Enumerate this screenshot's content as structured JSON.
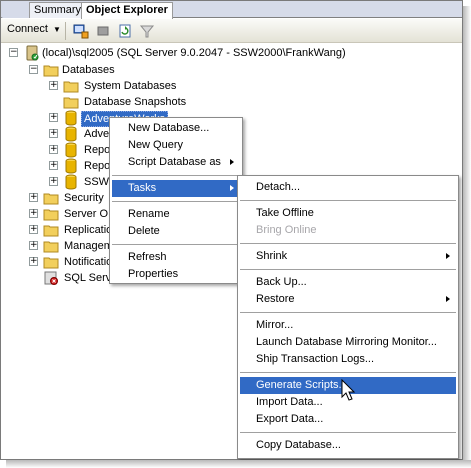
{
  "tabs": [
    {
      "label": "Summary"
    },
    {
      "label": "Object Explorer"
    }
  ],
  "toolbar": {
    "connect_label": "Connect"
  },
  "tree": {
    "server": "(local)\\sql2005 (SQL Server 9.0.2047 - SSW2000\\FrankWang)",
    "databases": "Databases",
    "system_databases": "System Databases",
    "snapshots": "Database Snapshots",
    "db1": "AdventureWorks",
    "db2": "Adve",
    "db3": "Repo",
    "db4": "Repo",
    "db5": "SSWS",
    "security": "Security",
    "server_objects": "Server O",
    "replication": "Replicatio",
    "management": "Managem",
    "notification": "Notificatio",
    "agent": "SQL Serv"
  },
  "context_menu": {
    "new_database": "New Database...",
    "new_query": "New Query",
    "script_database": "Script Database as",
    "tasks": "Tasks",
    "rename": "Rename",
    "delete": "Delete",
    "refresh": "Refresh",
    "properties": "Properties"
  },
  "tasks_menu": {
    "detach": "Detach...",
    "take_offline": "Take Offline",
    "bring_online": "Bring Online",
    "shrink": "Shrink",
    "back_up": "Back Up...",
    "restore": "Restore",
    "mirror": "Mirror...",
    "launch_mirroring": "Launch Database Mirroring Monitor...",
    "ship_logs": "Ship Transaction Logs...",
    "generate_scripts": "Generate Scripts...",
    "import_data": "Import Data...",
    "export_data": "Export Data...",
    "copy_database": "Copy Database..."
  },
  "colors": {
    "highlight": "#316ac5",
    "folder": "#f2cf5c",
    "database": "#e8b400"
  }
}
